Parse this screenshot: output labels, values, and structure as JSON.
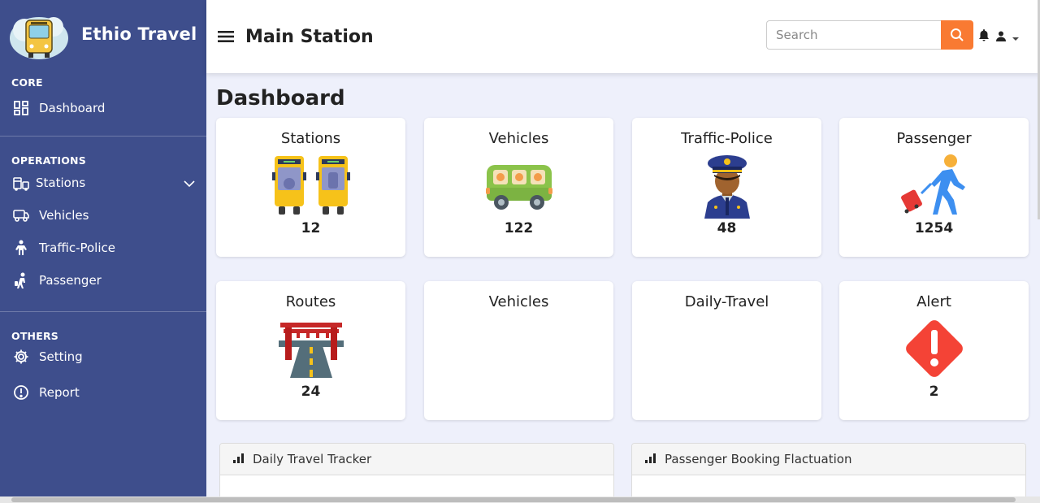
{
  "sidebar": {
    "brand": "Ethio Travel",
    "sections": {
      "core": "CORE",
      "operations": "OPERATIONS",
      "others": "OTHERS"
    },
    "items": {
      "dashboard": "Dashboard",
      "stations": "Stations",
      "vehicles": "Vehicles",
      "traffic_police": "Traffic-Police",
      "passenger": "Passenger",
      "setting": "Setting",
      "report": "Report"
    }
  },
  "topbar": {
    "page_name": "Main Station",
    "search_placeholder": "Search"
  },
  "main": {
    "title": "Dashboard",
    "cards": [
      {
        "title": "Stations",
        "value": "12",
        "icon": "bus-station-icon"
      },
      {
        "title": "Vehicles",
        "value": "122",
        "icon": "bus-icon"
      },
      {
        "title": "Traffic-Police",
        "value": "48",
        "icon": "police-officer-icon"
      },
      {
        "title": "Passenger",
        "value": "1254",
        "icon": "traveler-icon"
      },
      {
        "title": "Routes",
        "value": "24",
        "icon": "road-gate-icon"
      },
      {
        "title": "Vehicles",
        "value": "",
        "icon": ""
      },
      {
        "title": "Daily-Travel",
        "value": "",
        "icon": ""
      },
      {
        "title": "Alert",
        "value": "2",
        "icon": "alert-icon"
      }
    ],
    "panels": {
      "daily_tracker": "Daily Travel Tracker",
      "booking": "Passenger Booking Flactuation"
    }
  },
  "colors": {
    "sidebar": "#3e4e8c",
    "accent": "#f97a32",
    "background": "#eef0fb"
  }
}
